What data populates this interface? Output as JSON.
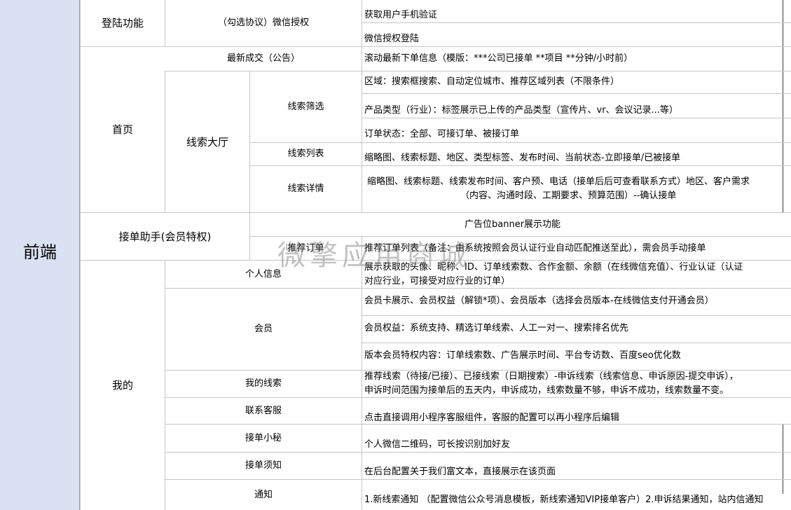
{
  "sidebar": {
    "label": "前端"
  },
  "sections": {
    "login": "登陆功能",
    "home": "首页",
    "assistant": "接单助手(会员特权)",
    "mine": "我的"
  },
  "features": {
    "wechat_auth": "（勾选协议）微信授权",
    "latest_deal": "最新成交（公告）",
    "lead_hall": "线索大厅",
    "lead_filter": "线索筛选",
    "lead_list": "线索列表",
    "lead_detail": "线索详情",
    "recommend_order": "推荐订单",
    "personal_info": "个人信息",
    "member": "会员",
    "my_leads": "我的线索",
    "contact_service": "联系客服",
    "order_secretary": "接单小秘",
    "order_notice": "接单须知",
    "notification": "通知"
  },
  "details": {
    "phone_verify": "获取用户手机验证",
    "wechat_login": "微信授权登陆",
    "scroll_orders": "滚动最新下单信息（模版：***公司已接单 **项目 **分钟/小时前）",
    "region": "区域：搜索框搜索、自动定位城市、推荐区域列表（不限条件）",
    "product_type": "产品类型（行业）：标签展示已上传的产品类型（宣传片、vr、会议记录...等）",
    "order_status": "订单状态：全部、可接订单、被接订单",
    "lead_list": "缩略图、线索标题、地区、类型标签、发布时间、当前状态-立即接单/已被接单",
    "lead_detail_1": "缩略图、线索标题、线索发布时间、客户预、电话（接单后后可查看联系方式）地区、客户需求",
    "lead_detail_2": "（内容、沟通时段、工期要求、预算范围）--确认接单",
    "banner": "广告位banner展示功能",
    "recommend_list": "推荐订单列表（备注：由系统按照会员认证行业自动匹配推送至此），需会员手动接单",
    "personal_1": "展示获取的头像、昵称、ID、订单线索数、合作金额、余额（在线微信充值）、行业认证（认证",
    "personal_2": "对应行业，可接受对应行业的订单）",
    "member_card": "会员卡展示、会员权益（解锁*项）、会员版本（选择会员版本-在线微信支付开通会员）",
    "member_rights": "会员权益：系统支持、精选订单线索、人工一对一、搜索排名优先",
    "version_rights": "版本会员特权内容：订单线索数、广告展示时间、平台专访数、百度seo优化数",
    "my_leads_1": "推荐线索（待接/已接）、已接线索（日期搜索）-申诉线索（线索信息、申诉原因-提交申诉），",
    "my_leads_2": "申诉时间范围为接单后的五天内，申诉成功，线索数量不够，申诉不成功，线索数量不变。",
    "service": "点击直接调用小程序客服组件，客服的配置可以再小程序后编辑",
    "qrcode": "个人微信二维码，可长按识别加好友",
    "rich_text": "在后台配置关于我们富文本，直接展示在该页面",
    "notify": "1.新线索通知 （配置微信公众号消息模板，新线索通知VIP接单客户）2.申诉结果通知，站内信通知"
  },
  "watermark": "微擎应用商城"
}
